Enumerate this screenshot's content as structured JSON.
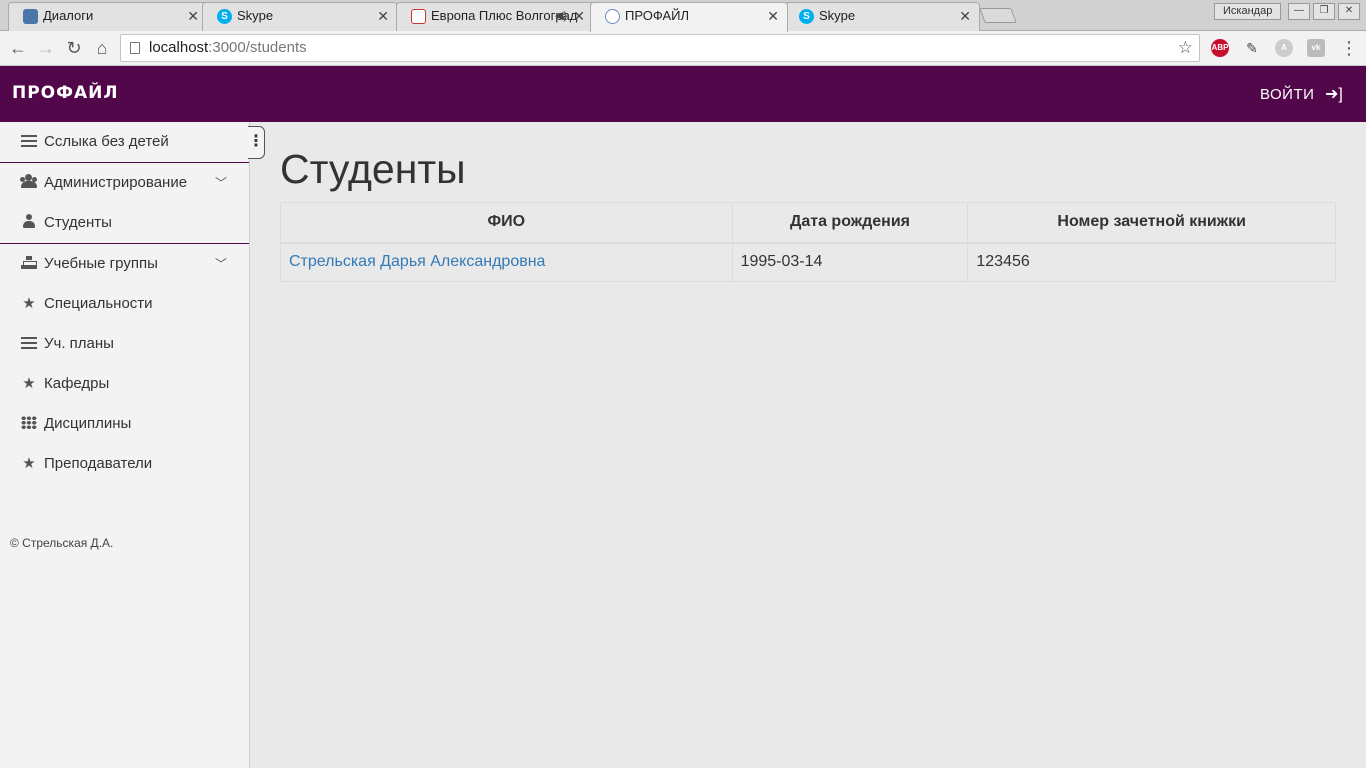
{
  "browser": {
    "tabs": [
      {
        "title": "Диалоги",
        "icon": "vk-icon"
      },
      {
        "title": "Skype",
        "icon": "skype-icon"
      },
      {
        "title": "Европа Плюс Волгоград",
        "icon": "europa-plus-icon",
        "audio": true
      },
      {
        "title": "ПРОФАЙЛ",
        "icon": "profile-site-icon",
        "active": true
      },
      {
        "title": "Skype",
        "icon": "skype-icon"
      }
    ],
    "profile_name": "Искандар",
    "address": {
      "host": "localhost",
      "path": ":3000/students"
    },
    "extensions": [
      "adblock-icon",
      "color-picker-icon",
      "angular-icon",
      "vk-extension-icon"
    ],
    "abp_label": "ABP"
  },
  "app": {
    "brand": "ПРОФАЙЛ",
    "login_label": "ВОЙТИ",
    "accent_color": "#52074a"
  },
  "sidebar": {
    "items": [
      {
        "label": "Сслыка без детей",
        "icon": "list-icon"
      },
      {
        "label": "Администрирование",
        "icon": "users-icon",
        "expandable": true
      },
      {
        "label": "Студенты",
        "icon": "user-icon"
      },
      {
        "label": "Учебные группы",
        "icon": "sitemap-icon",
        "expandable": true
      },
      {
        "label": "Специальности",
        "icon": "star-icon"
      },
      {
        "label": "Уч. планы",
        "icon": "list-icon"
      },
      {
        "label": "Кафедры",
        "icon": "star-icon"
      },
      {
        "label": "Дисциплины",
        "icon": "grid-icon"
      },
      {
        "label": "Преподаватели",
        "icon": "star-icon"
      }
    ],
    "footer": "© Стрельская Д.А."
  },
  "main": {
    "title": "Студенты",
    "table": {
      "headers": [
        "ФИО",
        "Дата рождения",
        "Номер зачетной книжки"
      ],
      "rows": [
        [
          "Стрельская Дарья Александровна",
          "1995-03-14",
          "123456"
        ]
      ]
    }
  }
}
